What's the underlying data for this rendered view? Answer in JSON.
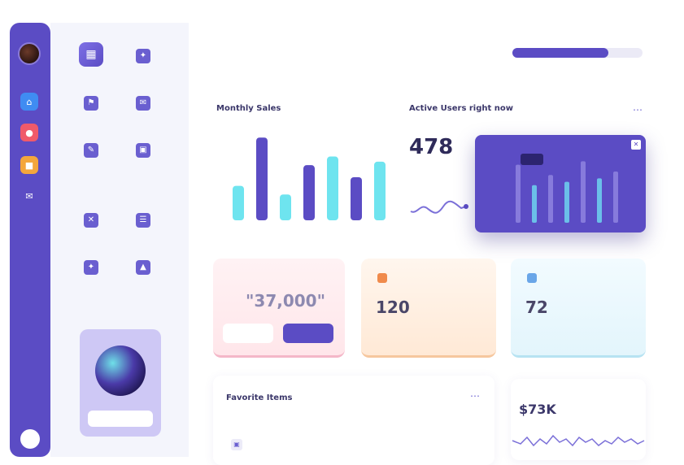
{
  "rail": {
    "icons": [
      {
        "name": "blue-app-icon",
        "color": "#3f8cf2",
        "glyph": "⌂"
      },
      {
        "name": "red-app-icon",
        "color": "#f05a6a",
        "glyph": "●"
      },
      {
        "name": "orange-app-icon",
        "color": "#f4a63c",
        "glyph": "■"
      },
      {
        "name": "chat-icon",
        "color": "transparent",
        "glyph": "✉"
      }
    ]
  },
  "apps": {
    "section_1": "",
    "section_2": "",
    "items": [
      {
        "icon": "dashboard-icon",
        "glyph": "▦",
        "label": ""
      },
      {
        "icon": "apps-icon",
        "glyph": "✦",
        "label": ""
      },
      {
        "icon": "bookmark-icon",
        "glyph": "⚑",
        "label": ""
      },
      {
        "icon": "mail-icon",
        "glyph": "✉",
        "label": ""
      },
      {
        "icon": "chat-icon",
        "glyph": "✎",
        "label": ""
      },
      {
        "icon": "calendar-icon",
        "glyph": "▣",
        "label": ""
      },
      {
        "icon": "user-icon",
        "glyph": "✕",
        "label": ""
      },
      {
        "icon": "grid-icon",
        "glyph": "☰",
        "label": ""
      },
      {
        "icon": "settings-icon",
        "glyph": "✦",
        "label": ""
      },
      {
        "icon": "folder-icon",
        "glyph": "▲",
        "label": ""
      }
    ],
    "promo_button": ""
  },
  "header": {
    "overline": "",
    "stats": [
      {
        "value": "",
        "label": ""
      },
      {
        "value": "",
        "label": ""
      },
      {
        "value": "",
        "label": ""
      },
      {
        "value": "",
        "label": ""
      }
    ],
    "progress": {
      "label": "",
      "fraction": 0.74,
      "sublabel": ""
    }
  },
  "monthly_sales": {
    "title": "Monthly Sales",
    "chart_data": {
      "type": "bar",
      "title": "Monthly Sales",
      "xlabel": "",
      "ylabel": "",
      "ylim": [
        0,
        100
      ],
      "grid": false,
      "categories": [
        "",
        "",
        "",
        "",
        "",
        "",
        ""
      ],
      "values": [
        40,
        96,
        30,
        64,
        74,
        50,
        68
      ],
      "colors": [
        "#6ee4ef",
        "#5b4cc4",
        "#6ee4ef",
        "#5b4cc4",
        "#6ee4ef",
        "#5b4cc4",
        "#6ee4ef"
      ]
    }
  },
  "active_users": {
    "title": "Active Users right now",
    "number": "478",
    "sublabel": ""
  },
  "popup_chart": {
    "tooltip": "",
    "y_ticks": [
      "",
      "",
      "",
      ""
    ],
    "bars": [
      0.85,
      0.55,
      0.7,
      0.6,
      0.9,
      0.65,
      0.75
    ],
    "colors": {
      "bg": "#5b4cc4",
      "bar": "#8f84e0",
      "highlight": "#6fd3f0"
    }
  },
  "cards": {
    "pink": {
      "kicker": "",
      "value": "\"37,000\"",
      "secondary_button": "",
      "primary_button": ""
    },
    "orange": {
      "kicker": "",
      "value": "120",
      "footer": ""
    },
    "blue": {
      "kicker": "",
      "value": "72",
      "footer": ""
    }
  },
  "favorites": {
    "title": "Favorite Items",
    "subtitle": "",
    "row_label": "",
    "row_price": ""
  },
  "revenue": {
    "title": "",
    "filter": "",
    "value": "$73K",
    "delta": ""
  }
}
